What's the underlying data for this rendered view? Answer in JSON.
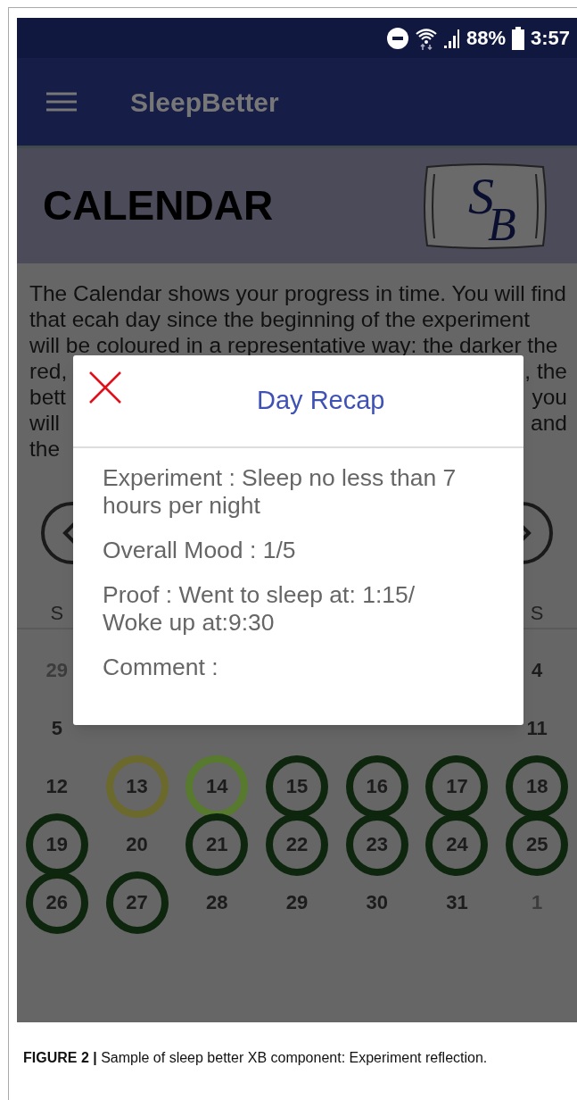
{
  "status_bar": {
    "battery": "88%",
    "time": "3:57"
  },
  "app_bar": {
    "title": "SleepBetter"
  },
  "header": {
    "title": "CALENDAR",
    "logo_letters": [
      "S",
      "B"
    ]
  },
  "intro": {
    "lines": [
      {
        "left": "The Calendar shows your progress in time. You will find"
      },
      {
        "left": "that ecah day since the beginning of the experiment"
      },
      {
        "left": "will be coloured in a representative way: the darker the"
      },
      {
        "left": "red,",
        "right": ", the"
      },
      {
        "left": "bett",
        "right": "you"
      },
      {
        "left": "will",
        "right": "and"
      },
      {
        "left": "the"
      }
    ]
  },
  "calendar": {
    "weekday_left": "S",
    "weekday_right": "S",
    "rows": [
      [
        {
          "day": "29",
          "other_month": true
        },
        null,
        null,
        null,
        null,
        null,
        {
          "day": "4",
          "other_month": false
        }
      ],
      [
        {
          "day": "5",
          "other_month": false
        },
        null,
        null,
        null,
        null,
        null,
        {
          "day": "11",
          "other_month": false
        }
      ],
      [
        {
          "day": "12",
          "other_month": false
        },
        {
          "day": "13",
          "other_month": false,
          "color": "#6b6a2c"
        },
        {
          "day": "14",
          "other_month": false,
          "color": "#587a2e"
        },
        {
          "day": "15",
          "other_month": false,
          "color": "#0e260e"
        },
        {
          "day": "16",
          "other_month": false,
          "color": "#0e260e"
        },
        {
          "day": "17",
          "other_month": false,
          "color": "#0e260e"
        },
        {
          "day": "18",
          "other_month": false,
          "color": "#0e260e"
        }
      ],
      [
        {
          "day": "19",
          "other_month": false,
          "color": "#0e260e"
        },
        {
          "day": "20",
          "other_month": false
        },
        {
          "day": "21",
          "other_month": false,
          "color": "#0e260e"
        },
        {
          "day": "22",
          "other_month": false,
          "color": "#0e260e"
        },
        {
          "day": "23",
          "other_month": false,
          "color": "#0e260e"
        },
        {
          "day": "24",
          "other_month": false,
          "color": "#0e260e"
        },
        {
          "day": "25",
          "other_month": false,
          "color": "#0e260e"
        }
      ],
      [
        {
          "day": "26",
          "other_month": false,
          "color": "#0e260e"
        },
        {
          "day": "27",
          "other_month": false,
          "color": "#0e260e"
        },
        {
          "day": "28",
          "other_month": false
        },
        {
          "day": "29",
          "other_month": false
        },
        {
          "day": "30",
          "other_month": false
        },
        {
          "day": "31",
          "other_month": false
        },
        {
          "day": "1",
          "other_month": true
        }
      ]
    ]
  },
  "dialog": {
    "title": "Day Recap",
    "fields": [
      "Experiment : Sleep no less than 7 hours per night",
      "Overall Mood : 1/5",
      "Proof : Went to sleep at: 1:15/ Woke up at:9:30",
      "Comment :"
    ]
  },
  "caption": "**FIGURE 2 |** Sample of sleep better XB component: Experiment reflection."
}
